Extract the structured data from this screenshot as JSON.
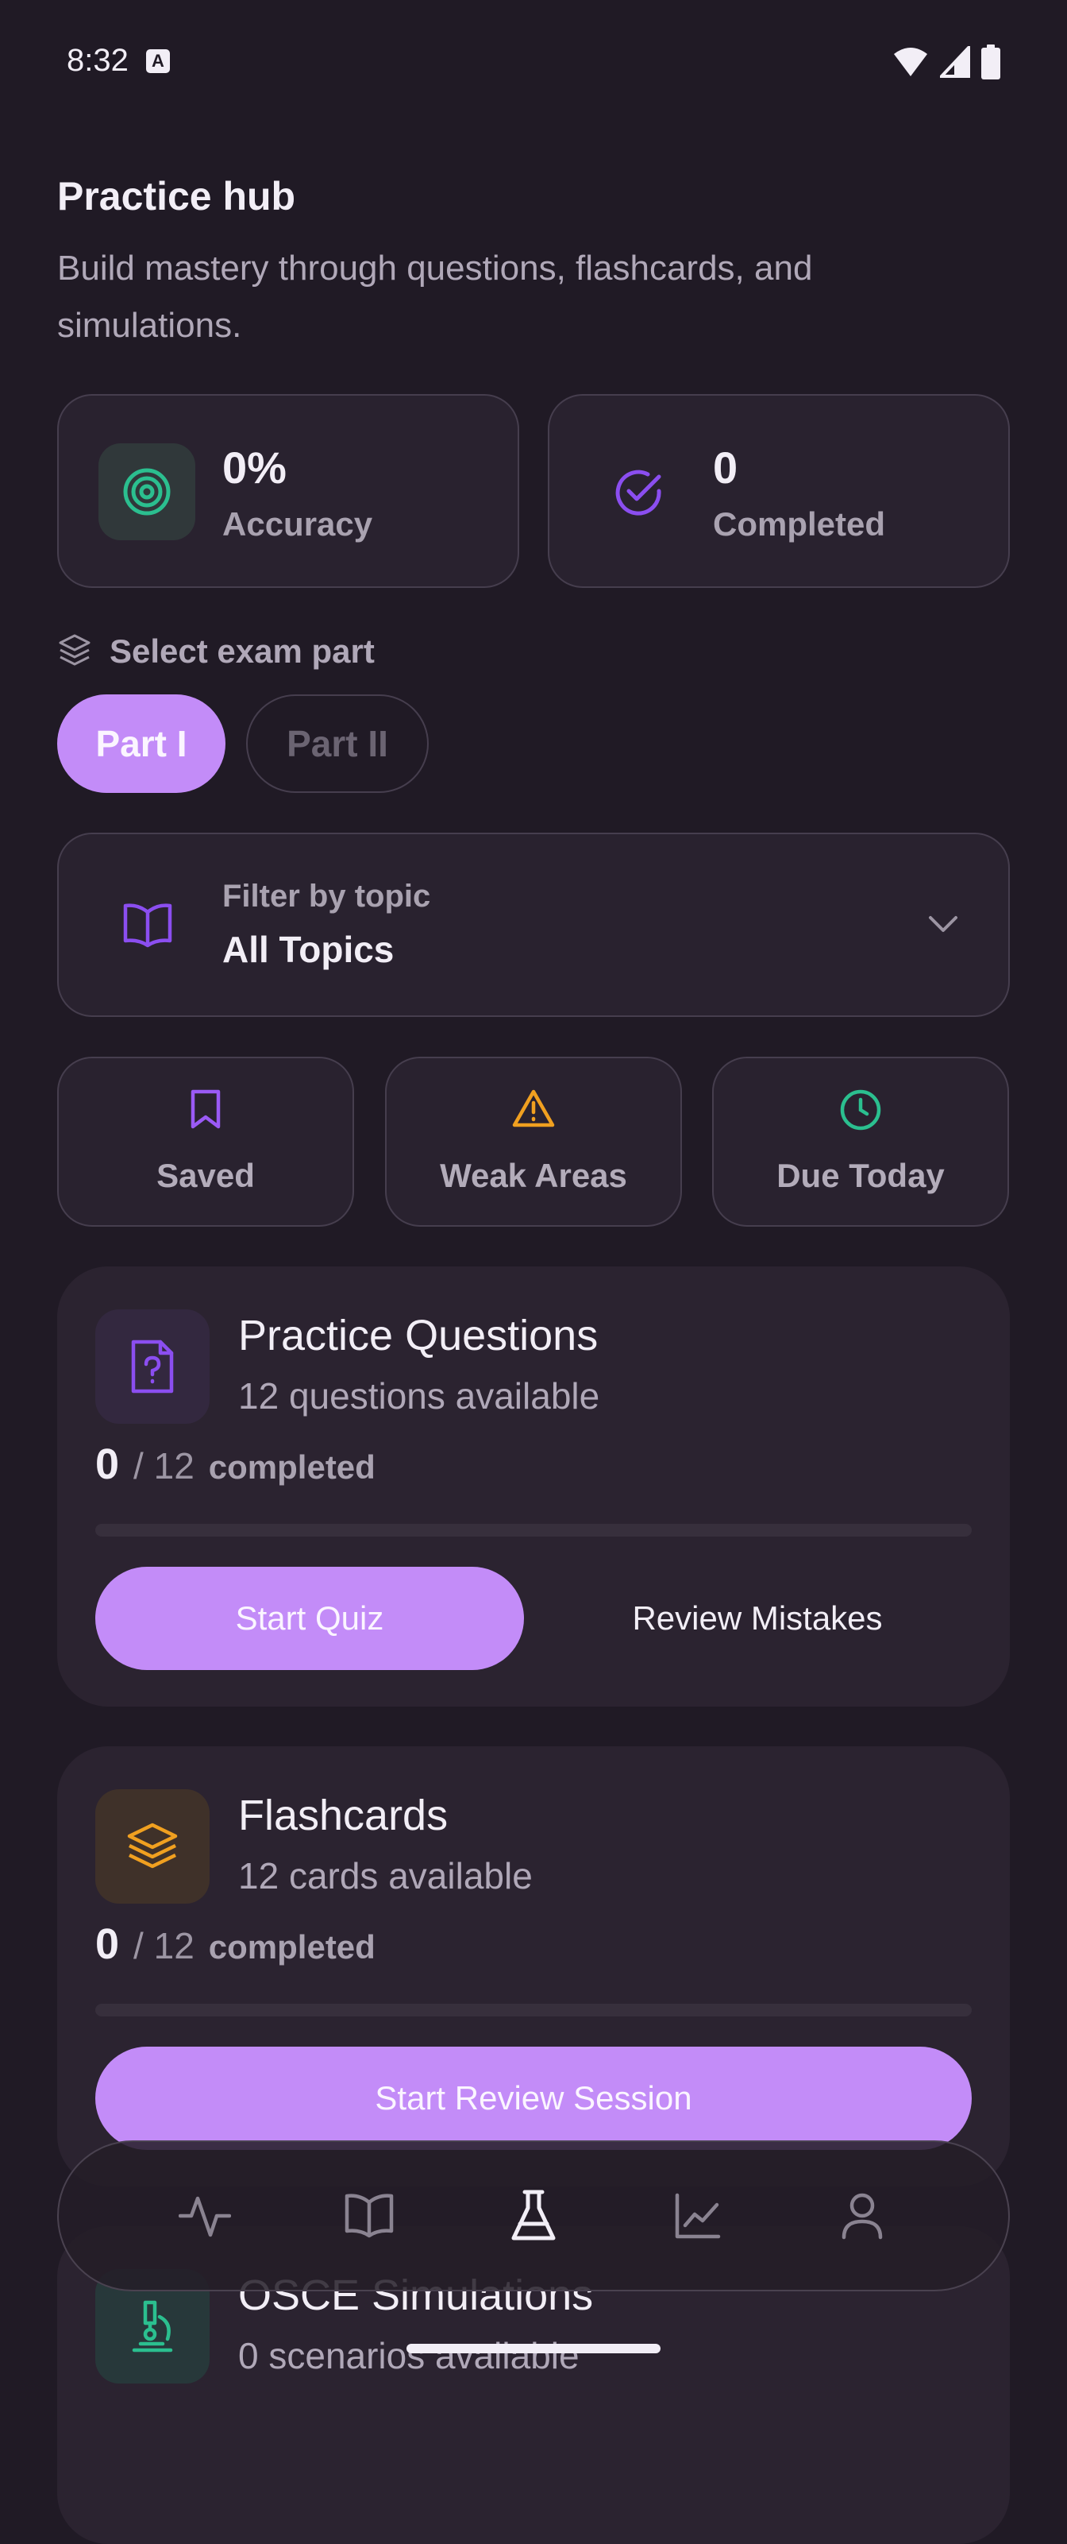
{
  "status_bar": {
    "time": "8:32",
    "notification_glyph": "A"
  },
  "header": {
    "title": "Practice hub",
    "subtitle": "Build mastery through questions, flashcards, and simulations."
  },
  "stats": [
    {
      "value": "0%",
      "label": "Accuracy",
      "icon": "target-icon",
      "color": "#2bbf8f"
    },
    {
      "value": "0",
      "label": "Completed",
      "icon": "check-circle-icon",
      "color": "#8b4ef0"
    }
  ],
  "exam_part": {
    "label": "Select exam part",
    "options": [
      "Part I",
      "Part II"
    ],
    "selected": "Part I"
  },
  "topic_filter": {
    "label": "Filter by topic",
    "value": "All Topics"
  },
  "quick_filters": [
    {
      "label": "Saved",
      "icon": "bookmark-icon",
      "color": "#9a5af5"
    },
    {
      "label": "Weak Areas",
      "icon": "warning-icon",
      "color": "#f0a020"
    },
    {
      "label": "Due Today",
      "icon": "clock-icon",
      "color": "#2bbf8f"
    }
  ],
  "practice_questions": {
    "title": "Practice Questions",
    "subtitle": "12 questions available",
    "done": "0",
    "total": "/ 12",
    "unit": "completed",
    "progress": 0,
    "primary_action": "Start Quiz",
    "secondary_action": "Review Mistakes"
  },
  "flashcards": {
    "title": "Flashcards",
    "subtitle": "12 cards available",
    "done": "0",
    "total": "/ 12",
    "unit": "completed",
    "progress": 0,
    "primary_action": "Start Review Session"
  },
  "osce": {
    "title": "OSCE Simulations",
    "subtitle": "0 scenarios available"
  },
  "nav": [
    {
      "name": "activity-icon",
      "active": false
    },
    {
      "name": "book-icon",
      "active": false
    },
    {
      "name": "flask-icon",
      "active": true
    },
    {
      "name": "chart-icon",
      "active": false
    },
    {
      "name": "profile-icon",
      "active": false
    }
  ],
  "colors": {
    "accent": "#c38cf8",
    "background": "#201a25",
    "card": "#2b2330"
  }
}
